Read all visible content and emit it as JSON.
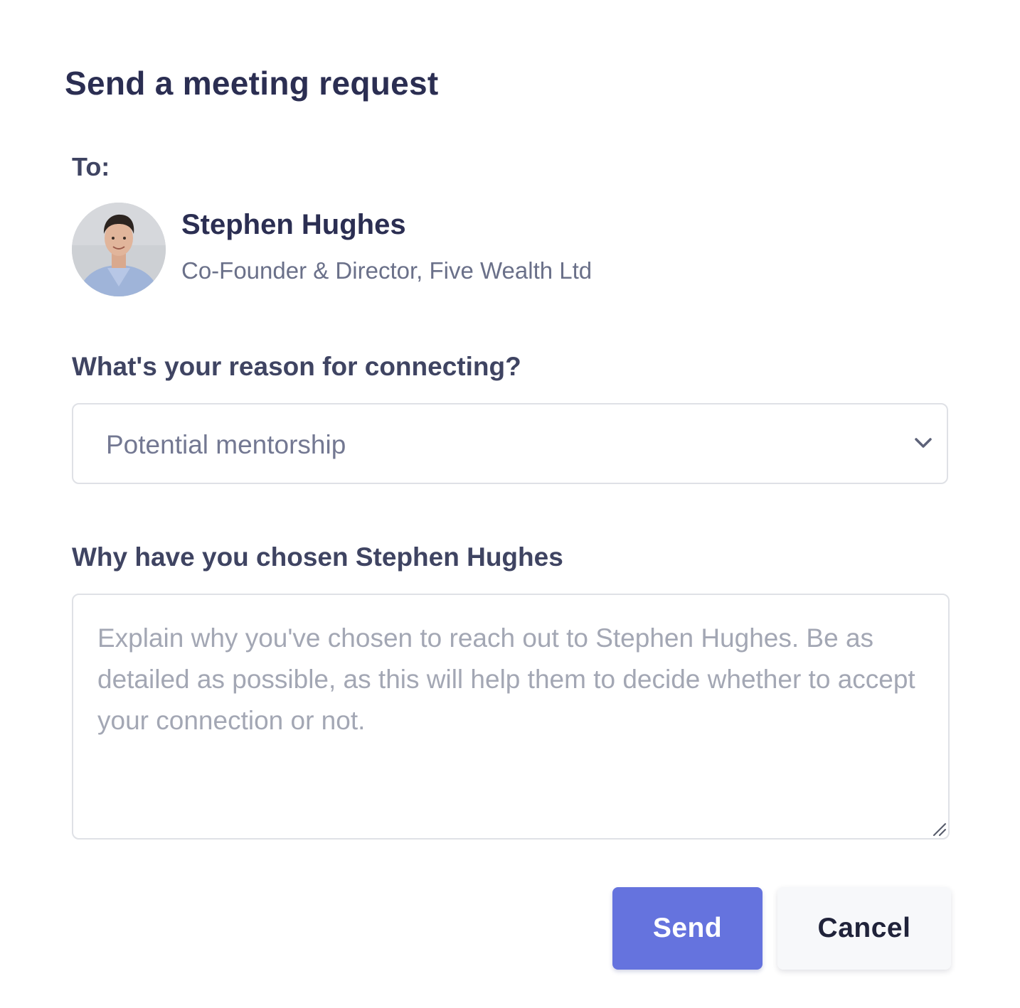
{
  "modal": {
    "title": "Send a meeting request"
  },
  "recipient": {
    "to_label": "To:",
    "name": "Stephen Hughes",
    "role": "Co-Founder & Director, Five Wealth Ltd",
    "avatar": "avatar-photo"
  },
  "reason": {
    "label": "What's your reason for connecting?",
    "selected": "Potential mentorship",
    "icon": "chevron-down-icon"
  },
  "why": {
    "label": "Why have you chosen Stephen Hughes",
    "placeholder": "Explain why you've chosen to reach out to Stephen Hughes. Be as detailed as possible, as this will help them to decide whether to accept your connection or not.",
    "value": ""
  },
  "actions": {
    "send_label": "Send",
    "cancel_label": "Cancel"
  },
  "colors": {
    "primary": "#6573de",
    "heading": "#2b2e52",
    "muted": "#6a7089",
    "border": "#dfe1e6"
  }
}
